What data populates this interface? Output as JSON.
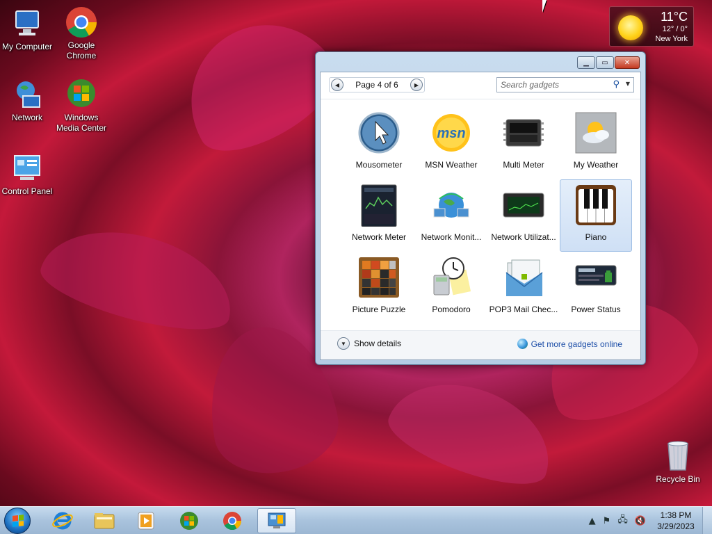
{
  "desktop": {
    "icons": [
      {
        "label": "My Computer",
        "icon": "computer-icon"
      },
      {
        "label": "Google Chrome",
        "icon": "chrome-icon"
      },
      {
        "label": "Network",
        "icon": "network-icon"
      },
      {
        "label": "Windows Media Center",
        "icon": "media-center-icon"
      },
      {
        "label": "Control Panel",
        "icon": "control-panel-icon"
      },
      {
        "label": "Recycle Bin",
        "icon": "recycle-bin-icon"
      }
    ]
  },
  "weather_gadget": {
    "temperature": "11°C",
    "range": "12° / 0°",
    "city": "New York",
    "icon": "sun-icon"
  },
  "gadget_window": {
    "page_label": "Page 4 of 6",
    "search_placeholder": "Search gadgets",
    "gadgets": [
      {
        "label": "Mousometer",
        "icon": "mousometer-icon"
      },
      {
        "label": "MSN Weather",
        "icon": "msn-icon"
      },
      {
        "label": "Multi Meter",
        "icon": "multi-meter-icon"
      },
      {
        "label": "My Weather",
        "icon": "my-weather-icon"
      },
      {
        "label": "Network Meter",
        "icon": "network-meter-icon"
      },
      {
        "label": "Network Monit...",
        "icon": "network-monitor-icon"
      },
      {
        "label": "Network Utilizat...",
        "icon": "network-utilization-icon"
      },
      {
        "label": "Piano",
        "icon": "piano-icon",
        "selected": true
      },
      {
        "label": "Picture Puzzle",
        "icon": "picture-puzzle-icon"
      },
      {
        "label": "Pomodoro",
        "icon": "pomodoro-icon"
      },
      {
        "label": "POP3 Mail Chec...",
        "icon": "pop3-mail-icon"
      },
      {
        "label": "Power Status",
        "icon": "power-status-icon"
      }
    ],
    "show_details": "Show details",
    "get_more": "Get more gadgets online"
  },
  "taskbar": {
    "pinned": [
      "internet-explorer-icon",
      "explorer-folder-icon",
      "media-player-icon",
      "media-center-icon",
      "chrome-icon",
      "gadgets-icon"
    ],
    "time": "1:38 PM",
    "date": "3/29/2023"
  }
}
